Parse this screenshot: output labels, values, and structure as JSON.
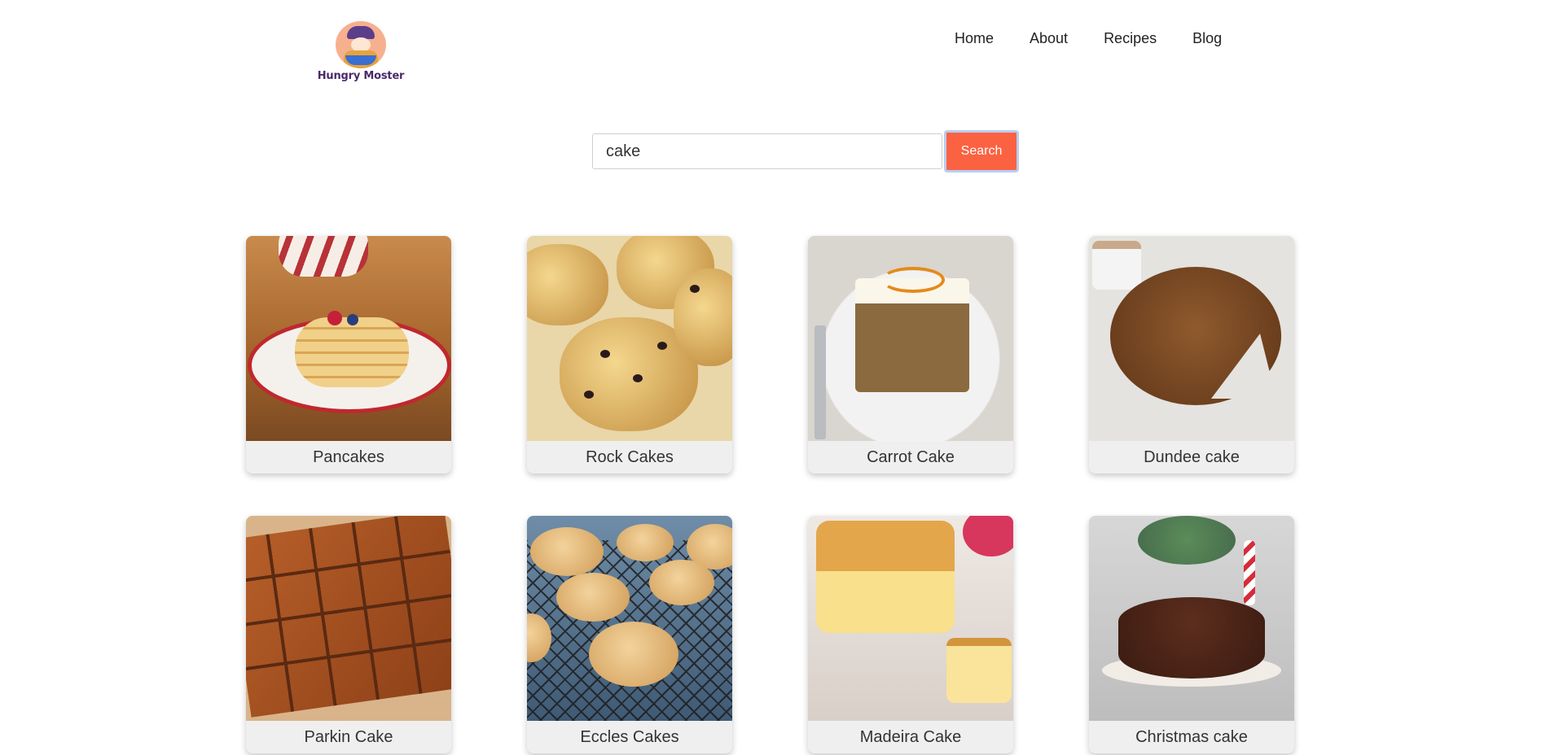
{
  "header": {
    "logo_text": "Hungry Moster",
    "nav": [
      {
        "label": "Home"
      },
      {
        "label": "About"
      },
      {
        "label": "Recipes"
      },
      {
        "label": "Blog"
      }
    ]
  },
  "search": {
    "value": "cake",
    "button_label": "Search"
  },
  "recipes": [
    {
      "title": "Pancakes"
    },
    {
      "title": "Rock Cakes"
    },
    {
      "title": "Carrot Cake"
    },
    {
      "title": "Dundee cake"
    },
    {
      "title": "Parkin Cake"
    },
    {
      "title": "Eccles Cakes"
    },
    {
      "title": "Madeira Cake"
    },
    {
      "title": "Christmas cake"
    }
  ],
  "colors": {
    "accent": "#fb6242",
    "card_bg": "#efefef"
  }
}
